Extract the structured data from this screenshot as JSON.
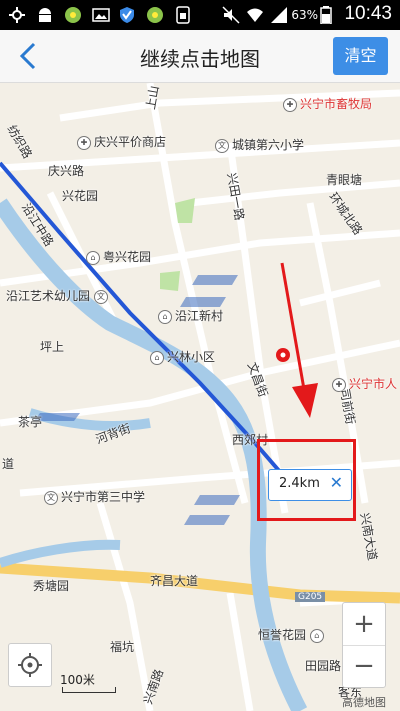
{
  "status_bar": {
    "battery_percent": "63%",
    "time": "10:43"
  },
  "header": {
    "back_icon": "chevron-left-icon",
    "title": "继续点击地图",
    "clear_label": "清空",
    "accent": "#3d8ee6"
  },
  "map": {
    "labels": {
      "shangshan": "上山",
      "xingning_animal": "兴宁市畜牧局",
      "qingxing_store": "庆兴平价商店",
      "chengxin_school": "城镇第六小学",
      "qingyan_pond": "青眼塘",
      "fangzhi_road": "纺织路",
      "qingxing_road": "庆兴路",
      "xinghua_garden": "兴花园",
      "xingtian_road": "兴田一路",
      "huancheng_north": "环城北路",
      "yanjiang_middle": "沿江中路",
      "yuexing_garden": "粤兴花园",
      "yanjiang_kindergarten": "沿江艺术幼儿园",
      "yanjiang_village": "沿江新村",
      "pingshang": "坪上",
      "xinglin_district": "兴林小区",
      "wenchang": "文昌街",
      "xingning_people": "兴宁市人",
      "chakeng": "茶亭",
      "hexing_street": "河背街",
      "ximen_village": "西郊村",
      "simen_road": "司前街",
      "xingning_third_middle": "兴宁市第三中学",
      "dao": "道",
      "xiuying_garden": "秀塘园",
      "qichang_avenue": "齐昌大道",
      "g205": "G205",
      "xingnan_avenue": "兴南大道",
      "fukeng": "福坑",
      "henyun_garden": "恒誉花园",
      "tianyuan_road": "田园路",
      "xingnan_road": "兴南路",
      "kejia_dong": "客东"
    },
    "distance": "2.4km",
    "distance_close": "✕",
    "scale": "100米",
    "brand": "高德地图",
    "zoom_in": "+",
    "zoom_out": "−",
    "route_color": "#2457d6",
    "annotation_color": "#e3191b"
  }
}
